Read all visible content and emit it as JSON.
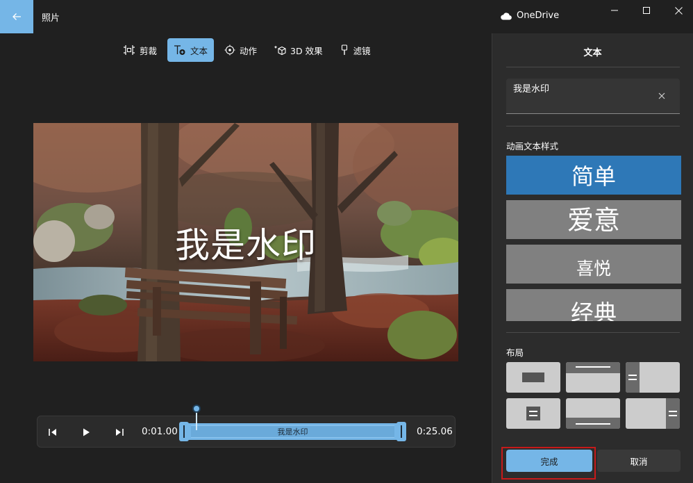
{
  "titlebar": {
    "app_title": "照片",
    "onedrive_label": "OneDrive"
  },
  "toolbar": {
    "items": [
      {
        "label": "剪裁",
        "icon": "crop-icon",
        "active": false
      },
      {
        "label": "文本",
        "icon": "text-icon",
        "active": true
      },
      {
        "label": "动作",
        "icon": "motion-icon",
        "active": false
      },
      {
        "label": "3D 效果",
        "icon": "3d-effects-icon",
        "active": false
      },
      {
        "label": "滤镜",
        "icon": "filter-icon",
        "active": false
      }
    ]
  },
  "preview": {
    "overlay_text": "我是水印"
  },
  "timeline": {
    "start_time": "0:01.00",
    "end_time": "0:25.06",
    "clip_label": "我是水印"
  },
  "panel": {
    "title": "文本",
    "text_input_value": "我是水印",
    "styles_label": "动画文本样式",
    "styles": [
      {
        "label": "简单",
        "selected": true
      },
      {
        "label": "爱意",
        "selected": false
      },
      {
        "label": "喜悦",
        "selected": false
      },
      {
        "label": "经典",
        "selected": false
      }
    ],
    "layout_label": "布局",
    "done_label": "完成",
    "cancel_label": "取消"
  },
  "colors": {
    "accent": "#75b6e7",
    "selected_style": "#2e78b7",
    "highlight_outline": "#c71a1a"
  }
}
